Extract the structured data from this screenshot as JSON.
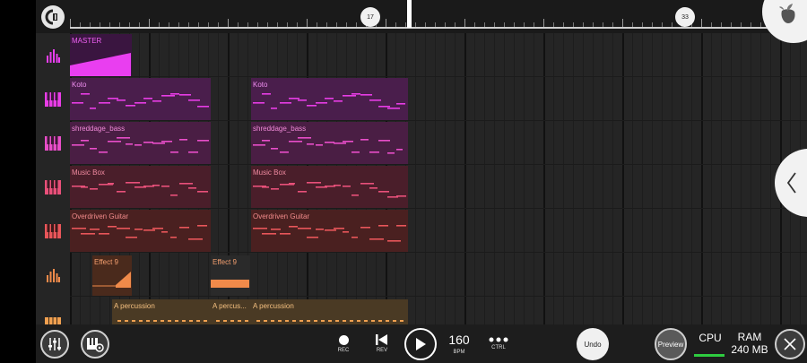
{
  "timeline": {
    "markers": [
      "17",
      "33"
    ]
  },
  "tracks": [
    {
      "name": "MASTER",
      "color": "#e93ef0"
    },
    {
      "name": "Koto",
      "color": "#e83de6"
    },
    {
      "name": "shreddage_bass",
      "color": "#e84ec9"
    },
    {
      "name": "Music Box",
      "color": "#e8507a"
    },
    {
      "name": "Overdriven Guitar",
      "color": "#e8565a"
    },
    {
      "name": "Effect 9",
      "color": "#f08a4a"
    },
    {
      "name": "A percussion",
      "color": "#f0a050"
    }
  ],
  "clips": {
    "master": "MASTER",
    "koto_1": "Koto",
    "koto_2": "Koto",
    "bass_1": "shreddage_bass",
    "bass_2": "shreddage_bass",
    "musicbox_1": "Music Box",
    "musicbox_2": "Music Box",
    "guitar_1": "Overdriven Guitar",
    "guitar_2": "Overdriven Guitar",
    "effect_1": "Effect 9",
    "effect_2": "Effect 9",
    "perc_1": "A percussion",
    "perc_2": "A percus...",
    "perc_3": "A percussion"
  },
  "transport": {
    "rec_label": "REC",
    "rev_label": "REV",
    "bpm_value": "160",
    "bpm_label": "BPM",
    "ctrl_label": "CTRL"
  },
  "actions": {
    "undo_label": "Undo",
    "preview_label": "Preview"
  },
  "status": {
    "cpu_label": "CPU",
    "ram_label": "RAM",
    "ram_value": "240 MB",
    "cpu_color": "#2ecc40"
  }
}
